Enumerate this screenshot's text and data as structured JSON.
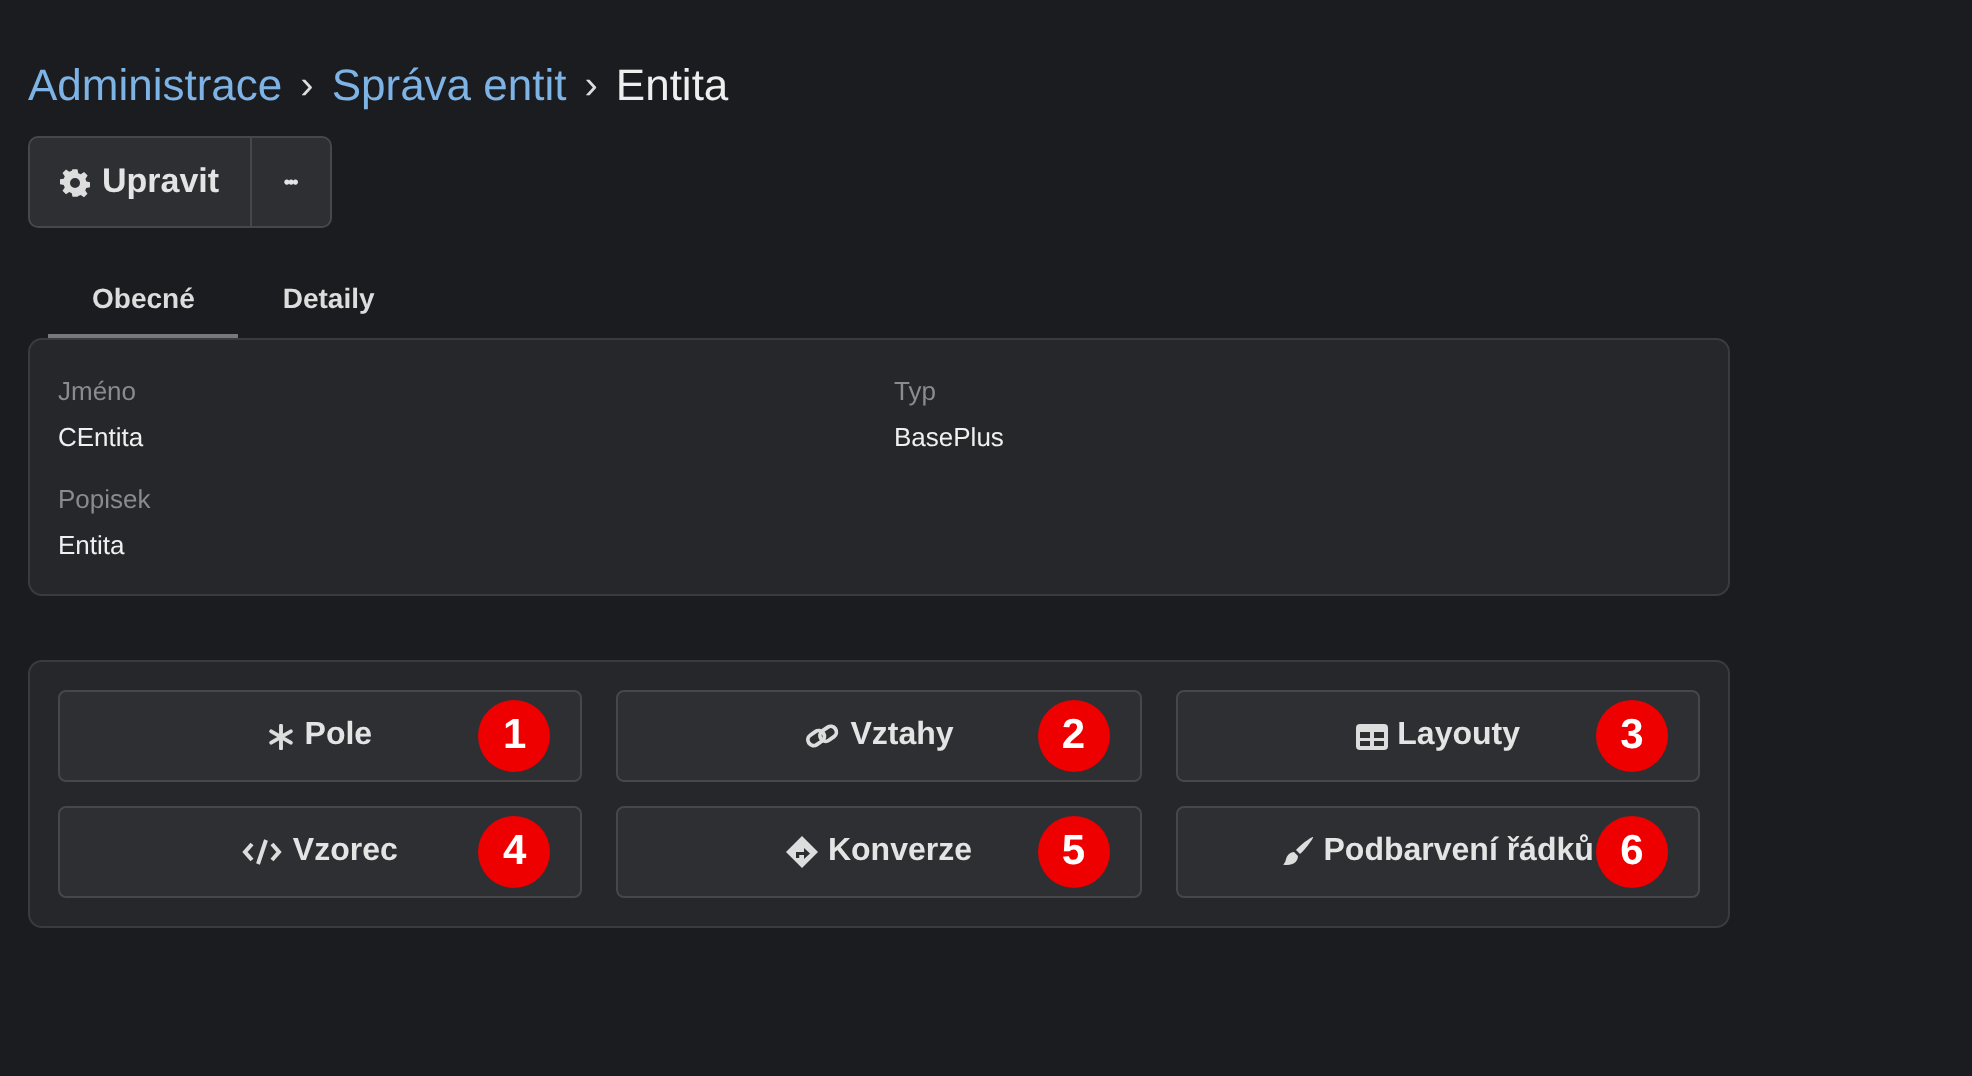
{
  "breadcrumb": [
    {
      "label": "Administrace",
      "kind": "link"
    },
    {
      "label": "›",
      "kind": "sep"
    },
    {
      "label": "Správa entit",
      "kind": "link"
    },
    {
      "label": "›",
      "kind": "sep"
    },
    {
      "label": "Entita",
      "kind": "current"
    }
  ],
  "toolbar": {
    "edit": "Upravit",
    "more": "•••"
  },
  "tabs": [
    {
      "label": "Obecné",
      "selected": true
    },
    {
      "label": "Detaily",
      "selected": false
    }
  ],
  "fields": [
    {
      "label": "Jméno",
      "value": "CEntita"
    },
    {
      "label": "Typ",
      "value": "BasePlus"
    },
    {
      "label": "Popisek",
      "value": "Entita"
    }
  ],
  "actions": [
    {
      "label": "Pole",
      "badge": "1"
    },
    {
      "label": "Vztahy",
      "badge": "2"
    },
    {
      "label": "Layouty",
      "badge": "3"
    },
    {
      "label": "Vzorec",
      "badge": "4"
    },
    {
      "label": "Konverze",
      "badge": "5"
    },
    {
      "label": "Podbarvení řádků",
      "badge": "6"
    }
  ]
}
